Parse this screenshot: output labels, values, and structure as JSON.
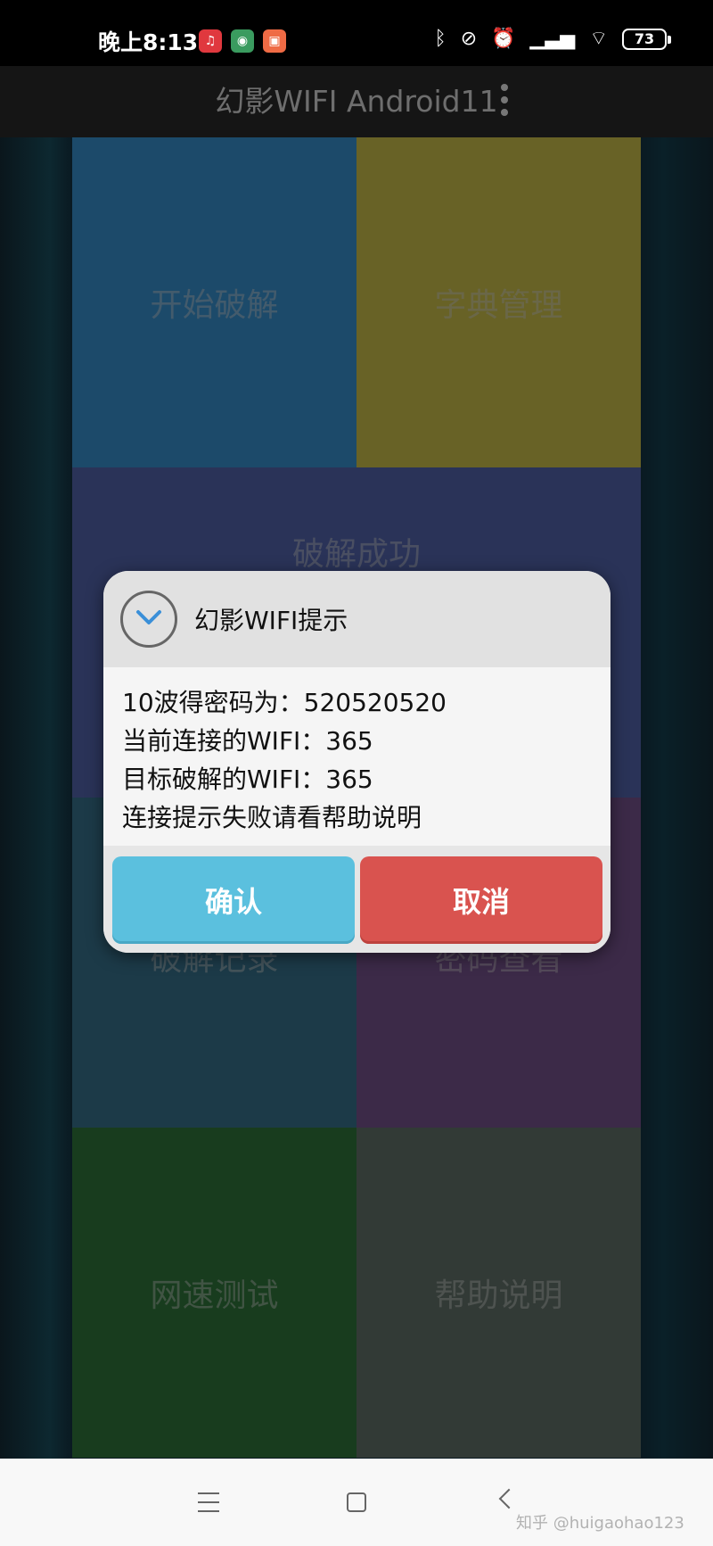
{
  "status_bar": {
    "time": "晚上8:13",
    "battery": "73",
    "notification_icons": [
      "netease-music-icon",
      "android-icon",
      "app-icon"
    ],
    "system_icons": [
      "bluetooth-icon",
      "mute-icon",
      "alarm-icon",
      "signal-icon",
      "hd-icon",
      "wifi-icon"
    ]
  },
  "app_bar": {
    "title": "幻影WIFI Android11"
  },
  "tiles": [
    {
      "label": "开始破解",
      "color": "#1c4a6a"
    },
    {
      "label": "字典管理",
      "color": "#686226"
    },
    {
      "label": "破解成功",
      "color": "#2a3358"
    },
    {
      "label": "破解记录",
      "color": "#1c3a48"
    },
    {
      "label": "密码查看",
      "color": "#3c2a48"
    },
    {
      "label": "网速测试",
      "color": "#183c1e"
    },
    {
      "label": "帮助说明",
      "color": "#323a36"
    }
  ],
  "dialog": {
    "title": "幻影WIFI提示",
    "lines": [
      "10波得密码为：520520520",
      "当前连接的WIFI：365",
      "目标破解的WIFI：365",
      "连接提示失败请看帮助说明"
    ],
    "confirm_label": "确认",
    "cancel_label": "取消",
    "confirm_color": "#5bc0de",
    "cancel_color": "#d9534f"
  },
  "watermark": "知乎 @huigaohao123"
}
